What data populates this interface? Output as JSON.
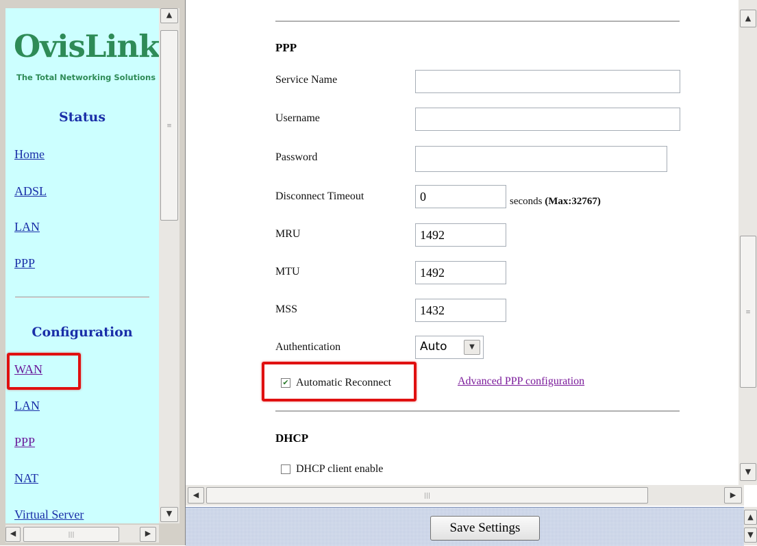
{
  "sidebar": {
    "logo_text": "OvisLink",
    "tagline": "The Total Networking Solutions",
    "status_title": "Status",
    "status_links": [
      "Home",
      "ADSL",
      "LAN",
      "PPP"
    ],
    "config_title": "Configuration",
    "config_links": [
      "WAN",
      "LAN",
      "PPP",
      "NAT",
      "Virtual Server"
    ]
  },
  "ppp": {
    "heading": "PPP",
    "service_name_label": "Service Name",
    "service_name_value": "",
    "username_label": "Username",
    "username_value": "",
    "password_label": "Password",
    "password_value": "",
    "disconnect_timeout_label": "Disconnect Timeout",
    "disconnect_timeout_value": "0",
    "seconds_text": "seconds",
    "max_text": "(Max:32767)",
    "mru_label": "MRU",
    "mru_value": "1492",
    "mtu_label": "MTU",
    "mtu_value": "1492",
    "mss_label": "MSS",
    "mss_value": "1432",
    "authentication_label": "Authentication",
    "authentication_value": "Auto",
    "auto_reconnect_label": "Automatic Reconnect",
    "auto_reconnect_checked": true,
    "advanced_link": "Advanced PPP configuration"
  },
  "dhcp": {
    "heading": "DHCP",
    "client_enable_label": "DHCP client enable",
    "client_enable_checked": false
  },
  "footer": {
    "save_label": "Save Settings"
  },
  "colors": {
    "sidebar_bg": "#ccffff",
    "link": "#1a2fa8",
    "visited_link": "#6a1a9a",
    "highlight": "#e01010",
    "logo": "#2e8b57"
  }
}
